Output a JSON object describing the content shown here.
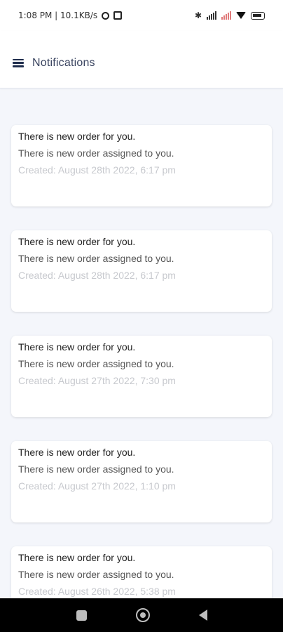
{
  "status_bar": {
    "time_speed": "1:08 PM | 10.1KB/s",
    "bluetooth_glyph": "✱"
  },
  "app_bar": {
    "title": "Notifications"
  },
  "notifications": [
    {
      "title": "There is new order for you.",
      "body": "There is new order assigned to you.",
      "created": "Created: August 28th 2022, 6:17 pm"
    },
    {
      "title": "There is new order for you.",
      "body": "There is new order assigned to you.",
      "created": "Created: August 28th 2022, 6:17 pm"
    },
    {
      "title": "There is new order for you.",
      "body": "There is new order assigned to you.",
      "created": "Created: August 27th 2022, 7:30 pm"
    },
    {
      "title": "There is new order for you.",
      "body": "There is new order assigned to you.",
      "created": "Created: August 27th 2022, 1:10 pm"
    },
    {
      "title": "There is new order for you.",
      "body": "There is new order assigned to you.",
      "created": "Created: August 26th 2022, 5:38 pm"
    }
  ],
  "colors": {
    "background": "#f4f6fb",
    "card": "#ffffff",
    "title_text": "#3a4460",
    "date_text": "#c7c9ce"
  },
  "icons": {
    "menu": "menu-icon",
    "alarm": "alarm-icon",
    "notification_square": "status-square-icon",
    "bluetooth": "bluetooth-icon",
    "signal": "signal-icon",
    "wifi": "wifi-icon",
    "battery": "battery-icon",
    "nav_recents": "recents-icon",
    "nav_home": "home-icon",
    "nav_back": "back-icon"
  }
}
